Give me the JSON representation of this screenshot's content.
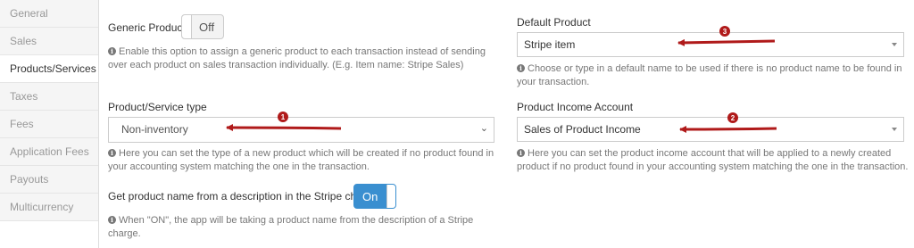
{
  "sidebar": {
    "items": [
      {
        "label": "General"
      },
      {
        "label": "Sales"
      },
      {
        "label": "Products/Services"
      },
      {
        "label": "Taxes"
      },
      {
        "label": "Fees"
      },
      {
        "label": "Application Fees"
      },
      {
        "label": "Payouts"
      },
      {
        "label": "Multicurrency"
      }
    ],
    "active": "Products/Services"
  },
  "generic_product": {
    "label": "Generic Product",
    "toggle_text": "Off",
    "help_line1": "Enable this option to assign a generic product to each transaction instead of sending",
    "help_line2": "over each product on sales transaction individually. (E.g. Item name: Stripe Sales)"
  },
  "default_product": {
    "label": "Default Product",
    "value": "Stripe item",
    "help_line1": "Choose or type in a default name to be used if there is no product name to be found in",
    "help_line2": "your transaction."
  },
  "product_type": {
    "label": "Product/Service type",
    "value": "Non-inventory",
    "help_line1": "Here you can set the type of a new product which will be created if no product found in",
    "help_line2": "your accounting system matching the one in the transaction."
  },
  "income_account": {
    "label": "Product Income Account",
    "value": "Sales of Product Income",
    "help_line1": "Here you can set the product income account that will be applied to a newly created",
    "help_line2": "product if no product found in your accounting system matching the one in the transaction."
  },
  "description_option": {
    "label": "Get product name from a description in the Stripe charge",
    "toggle_text": "On",
    "help_line1": "When \"ON\", the app will be taking a product name from the description of a Stripe",
    "help_line2": "charge."
  },
  "annotations": {
    "badge1": "1",
    "badge2": "2",
    "badge3": "3",
    "color": "#b01a1a"
  },
  "icons": {
    "info": "info-circle-icon",
    "dropdown": "caret-down-icon",
    "native_select": "chevron-down-icon"
  },
  "colors": {
    "toggle_on": "#3a8fd0",
    "active_nav": "#ffffff",
    "inactive_nav": "#f5f5f5"
  }
}
